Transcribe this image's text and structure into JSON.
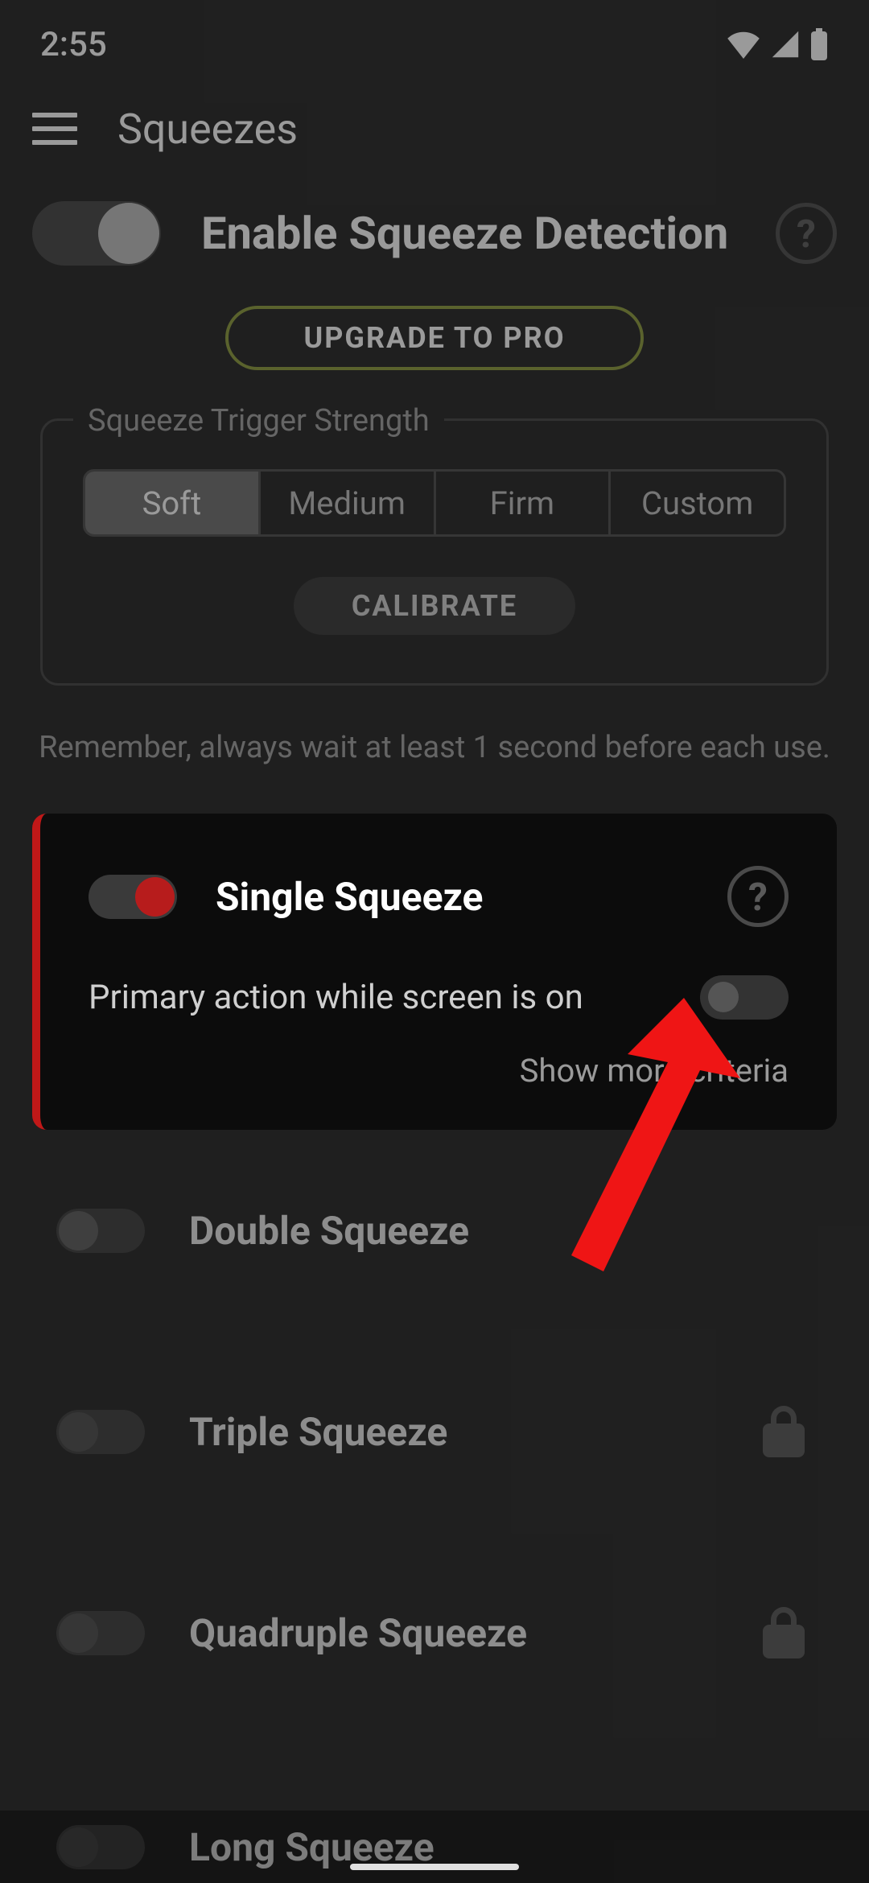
{
  "status": {
    "time": "2:55"
  },
  "appbar": {
    "title": "Squeezes"
  },
  "enable": {
    "label": "Enable Squeeze Detection"
  },
  "upgrade": {
    "label": "UPGRADE TO PRO"
  },
  "strength": {
    "legend": "Squeeze Trigger Strength",
    "options": [
      "Soft",
      "Medium",
      "Firm",
      "Custom"
    ],
    "calibrate": "CALIBRATE"
  },
  "hint": "Remember, always wait at least 1 second before each use.",
  "single": {
    "title": "Single Squeeze",
    "subtitle": "Primary action while screen is on",
    "link": "Show more criteria"
  },
  "items": [
    {
      "label": "Double Squeeze",
      "locked": false
    },
    {
      "label": "Triple Squeeze",
      "locked": true
    },
    {
      "label": "Quadruple Squeeze",
      "locked": true
    }
  ],
  "long": {
    "label": "Long Squeeze"
  }
}
